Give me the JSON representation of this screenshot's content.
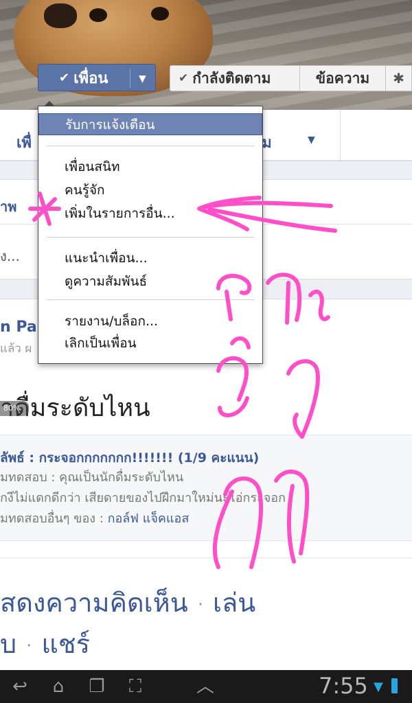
{
  "header": {
    "friend_button_label": "เพื่อน",
    "following_button_label": "กำลังติดตาม",
    "message_button_label": "ข้อความ"
  },
  "friend_menu": {
    "items": [
      {
        "label": "รับการแจ้งเตือน",
        "highlighted": true
      },
      {
        "label": "เพื่อนสนิท"
      },
      {
        "label": "คนรู้จัก"
      },
      {
        "label": "เพิ่มในรายการอื่น..."
      },
      {
        "label": "แนะนำเพื่อน..."
      },
      {
        "label": "ดูความสัมพันธ์"
      },
      {
        "label": "รายงาน/บล็อก..."
      },
      {
        "label": "เลิกเป็นเพื่อน"
      }
    ]
  },
  "tabs": {
    "friends": "เพื่",
    "more": "มเติม"
  },
  "feed": {
    "photo_link": "าพ",
    "status_snippet": "ง...",
    "post_author": "n Pak",
    "post_time": "แล้ว ผ",
    "post_title": "าดื่มระดับไหน",
    "image_badge": "80%",
    "quiz_result": "ลัพธ์ : กระจอกกกกกกก!!!!!!! (1/9 คะแนน)",
    "quiz_from": "มทดสอบ : คุณเป็นนักดื่มระดับไหน",
    "quiz_desc": "กงีไม่แดกดีกว่า เสียดายของไปฝึกมาใหม่นะไอ่กระจอก",
    "quiz_more_prefix": "มทดสอบอื่นๆ ของ : ",
    "quiz_more_link": "กอล์ฟ แจ็คแอส",
    "action_show_comments": "สดงความคิดเห็น",
    "action_play": "เล่น",
    "action_frag": "บ",
    "action_share": "แชร์",
    "action_separator": "·"
  },
  "annotation": {
    "handwritten_text": "การตั้งค่า",
    "color": "#ff4fc8"
  },
  "system_bar": {
    "time": "7:55"
  },
  "colors": {
    "facebook_blue": "#3b5998",
    "menu_highlight": "#6d84b4",
    "button_blue": "#5b74a8"
  }
}
